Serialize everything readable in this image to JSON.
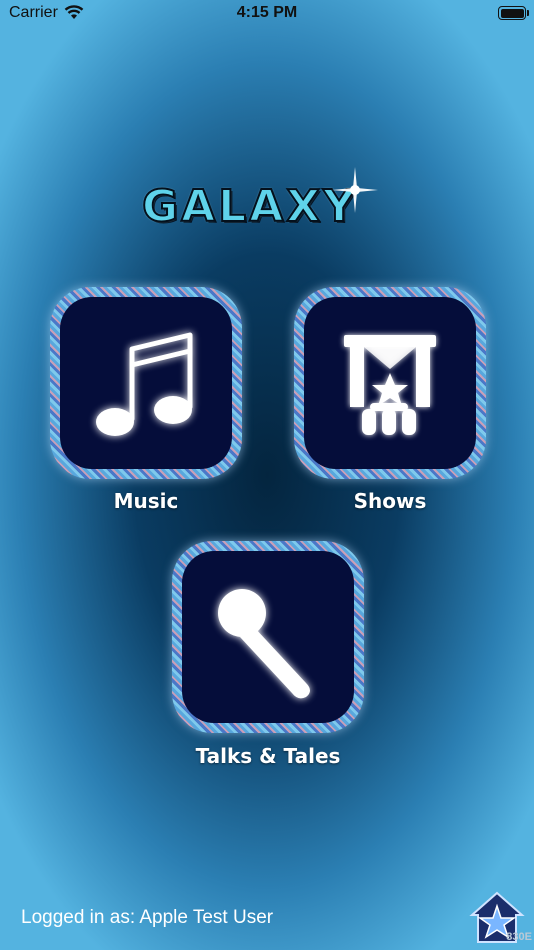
{
  "status_bar": {
    "carrier": "Carrier",
    "time": "4:15 PM"
  },
  "logo": {
    "text": "GALAXY"
  },
  "tiles": [
    {
      "label": "Music",
      "icon": "music-note-icon"
    },
    {
      "label": "Shows",
      "icon": "theater-stage-icon"
    },
    {
      "label": "Talks & Tales",
      "icon": "microphone-icon"
    }
  ],
  "footer": {
    "logged_in": "Logged in as: Apple Test User",
    "version": "830E",
    "home_icon": "star-house-icon"
  },
  "colors": {
    "tile_inner": "#050d3a",
    "logo_fill": "#5fd3ea",
    "background_center": "#04253f",
    "background_edge": "#54b3e0"
  }
}
